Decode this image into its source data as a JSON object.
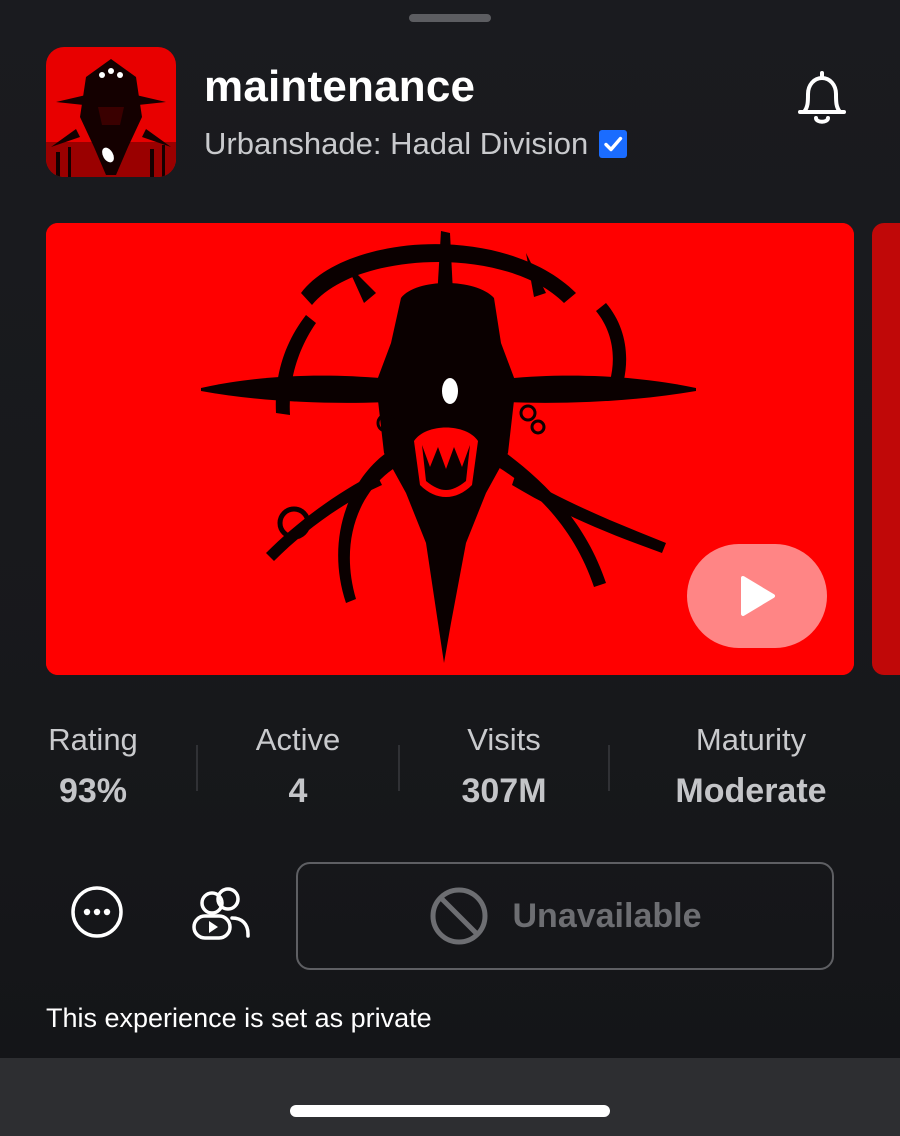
{
  "game": {
    "title": "maintenance",
    "creator": "Urbanshade: Hadal Division",
    "creator_verified": true
  },
  "icons": {
    "notification": "bell-icon",
    "verified": "verified-check-icon",
    "play": "play-icon",
    "more": "more-options-icon",
    "party": "party-icon",
    "unavailable": "blocked-icon"
  },
  "stats": [
    {
      "label": "Rating",
      "value": "93%"
    },
    {
      "label": "Active",
      "value": "4"
    },
    {
      "label": "Visits",
      "value": "307M"
    },
    {
      "label": "Maturity",
      "value": "Moderate"
    }
  ],
  "actions": {
    "play_label": "Unavailable"
  },
  "notice": "This experience is set as private",
  "colors": {
    "background": "#1a1b1e",
    "thumbnail_red": "#ff0000",
    "play_button": "#ff8585",
    "verified_blue": "#1a6cff",
    "disabled_text": "#6d6e72"
  }
}
